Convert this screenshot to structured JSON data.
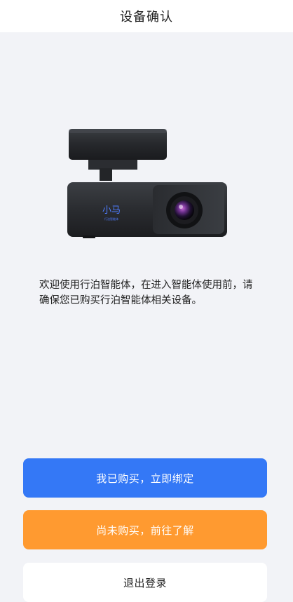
{
  "header": {
    "title": "设备确认"
  },
  "device": {
    "brand_mark": "小马",
    "brand_sub": "行泊智能体"
  },
  "intro": {
    "text": "欢迎使用行泊智能体，在进入智能体使用前，请确保您已购买行泊智能体相关设备。"
  },
  "actions": {
    "bind_label": "我已购买，立即绑定",
    "learn_label": "尚未购买，前往了解",
    "logout_label": "退出登录"
  },
  "colors": {
    "primary": "#3478f6",
    "secondary": "#ff9a30",
    "background": "#f2f3f7"
  }
}
